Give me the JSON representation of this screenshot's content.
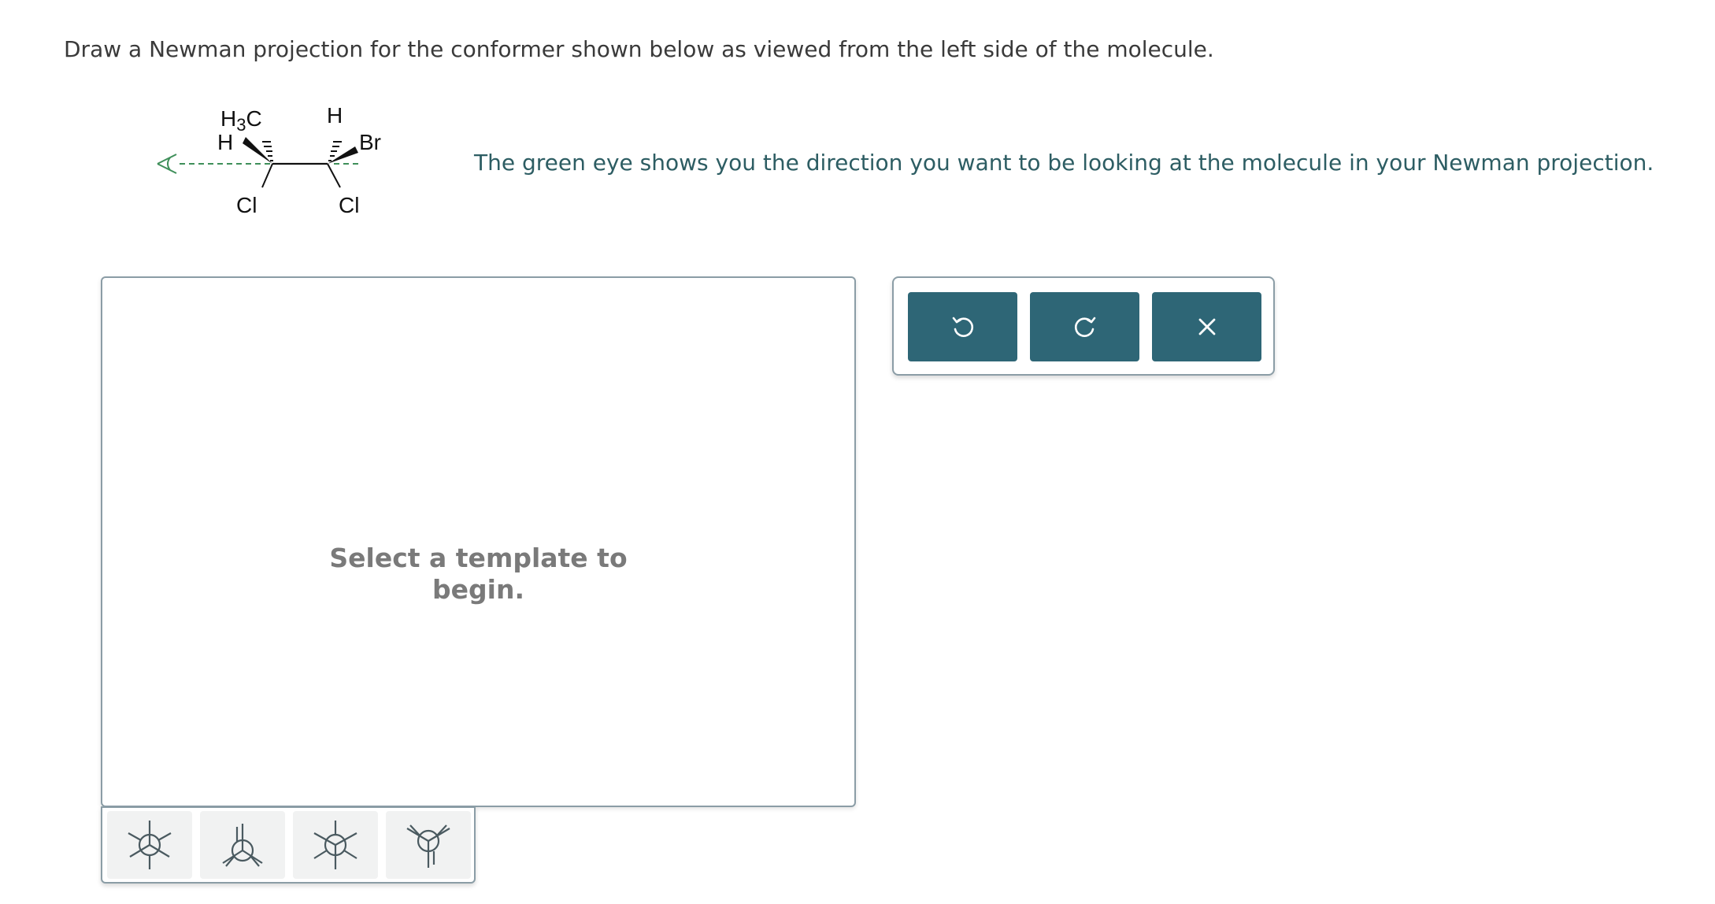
{
  "question": {
    "text": "Draw a Newman projection for the conformer shown below as viewed from the left side of the molecule."
  },
  "molecule": {
    "labels": {
      "h3c": "H3C",
      "h_left": "H",
      "cl_left": "Cl",
      "h_top": "H",
      "br": "Br",
      "cl_right": "Cl"
    },
    "eye_color": "#3f8f5a"
  },
  "hint": {
    "text": "The green eye shows you the direction you want to be looking at the molecule in your Newman projection."
  },
  "canvas": {
    "empty_message": "Select a template to begin."
  },
  "templates": [
    {
      "name": "staggered-newman-template",
      "icon": "newman-staggered-icon"
    },
    {
      "name": "eclipsed-newman-template",
      "icon": "newman-eclipsed-icon"
    },
    {
      "name": "staggered-newman-template-2",
      "icon": "newman-staggered-alt-icon"
    },
    {
      "name": "eclipsed-newman-template-2",
      "icon": "newman-eclipsed-alt-icon"
    }
  ],
  "toolbar": {
    "buttons": [
      {
        "name": "undo-button",
        "icon": "undo-icon"
      },
      {
        "name": "redo-button",
        "icon": "redo-icon"
      },
      {
        "name": "clear-button",
        "icon": "close-icon"
      }
    ],
    "button_color": "#2e6676"
  },
  "colors": {
    "hint_text": "#2d5d63",
    "border": "#8b9da6"
  }
}
